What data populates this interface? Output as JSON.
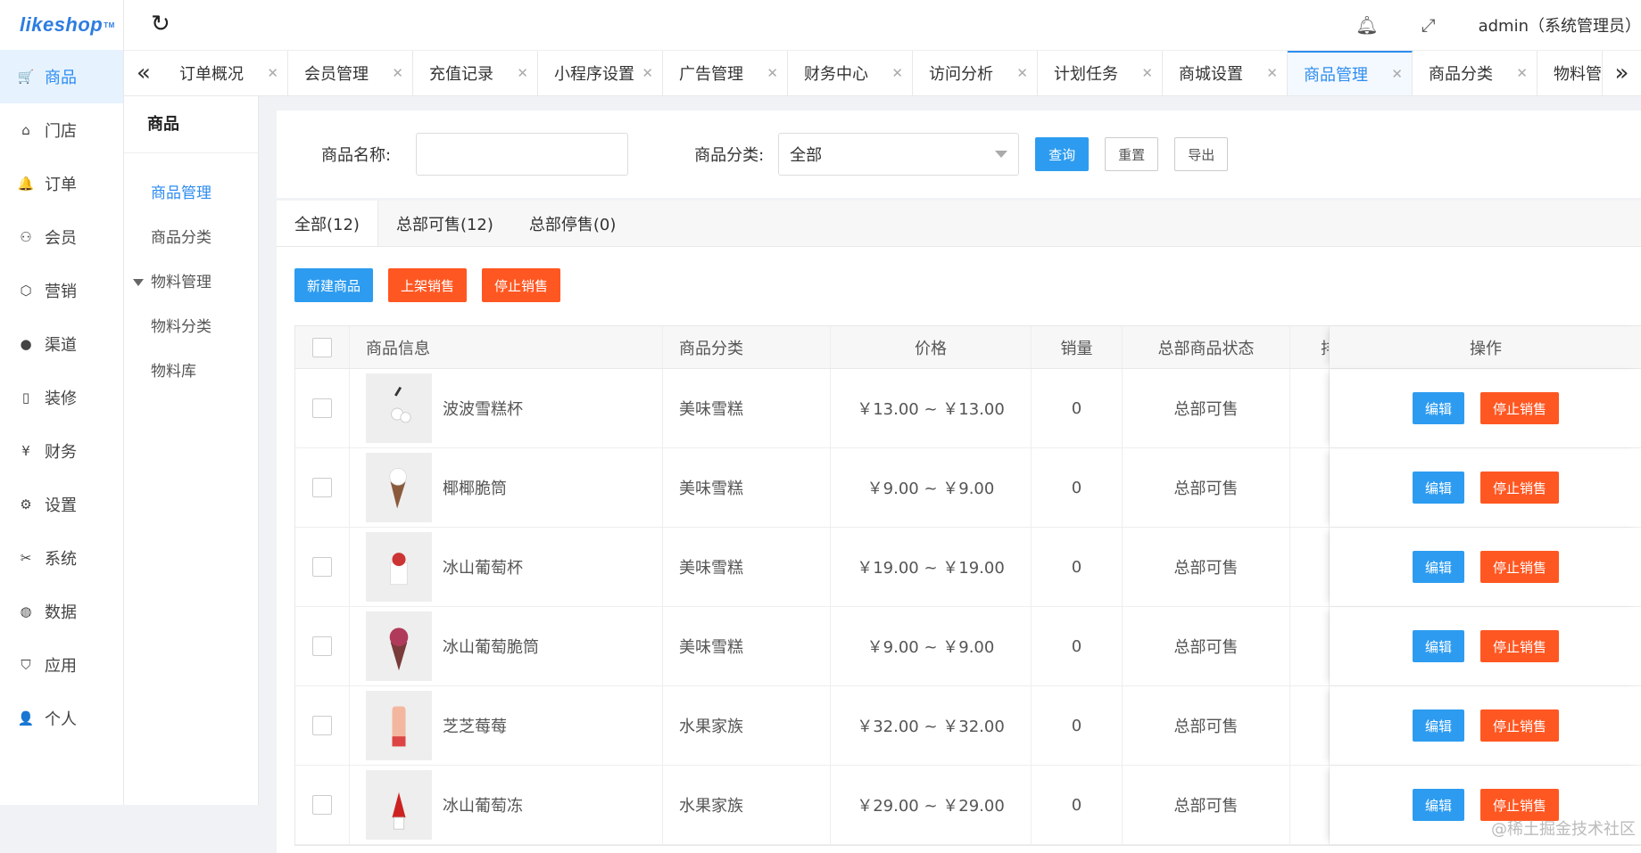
{
  "app": {
    "logo": "likeshop",
    "logo_tm": "TM"
  },
  "sidebar": {
    "items": [
      {
        "label": "商品",
        "icon": "cart-icon",
        "glyph": "🛒",
        "active": true
      },
      {
        "label": "门店",
        "icon": "home-icon",
        "glyph": "⌂"
      },
      {
        "label": "订单",
        "icon": "bell-icon",
        "glyph": "🔔"
      },
      {
        "label": "会员",
        "icon": "user-icon",
        "glyph": "⚇"
      },
      {
        "label": "营销",
        "icon": "cube-icon",
        "glyph": "⬡"
      },
      {
        "label": "渠道",
        "icon": "wechat-icon",
        "glyph": "●"
      },
      {
        "label": "装修",
        "icon": "tablet-icon",
        "glyph": "▯"
      },
      {
        "label": "财务",
        "icon": "yen-icon",
        "glyph": "¥"
      },
      {
        "label": "设置",
        "icon": "gear-icon",
        "glyph": "⚙"
      },
      {
        "label": "系统",
        "icon": "tools-icon",
        "glyph": "✂"
      },
      {
        "label": "数据",
        "icon": "globe-icon",
        "glyph": "◍"
      },
      {
        "label": "应用",
        "icon": "shield-check-icon",
        "glyph": "⛉"
      },
      {
        "label": "个人",
        "icon": "person-icon",
        "glyph": "👤"
      }
    ]
  },
  "header": {
    "user": "admin（系统管理员）"
  },
  "tabs": [
    {
      "label": "订单概况"
    },
    {
      "label": "会员管理"
    },
    {
      "label": "充值记录"
    },
    {
      "label": "小程序设置"
    },
    {
      "label": "广告管理"
    },
    {
      "label": "财务中心"
    },
    {
      "label": "访问分析"
    },
    {
      "label": "计划任务"
    },
    {
      "label": "商城设置"
    },
    {
      "label": "商品管理",
      "active": true
    },
    {
      "label": "商品分类"
    },
    {
      "label": "物料管理"
    }
  ],
  "subnav": {
    "title": "商品",
    "items": [
      {
        "label": "商品管理",
        "active": true
      },
      {
        "label": "商品分类"
      },
      {
        "label": "物料管理",
        "group": true
      },
      {
        "label": "物料分类"
      },
      {
        "label": "物料库"
      }
    ]
  },
  "filter": {
    "name_label": "商品名称:",
    "name_value": "",
    "category_label": "商品分类:",
    "category_value": "全部",
    "query_btn": "查询",
    "reset_btn": "重置",
    "export_btn": "导出"
  },
  "status_tabs": [
    {
      "label": "全部(12)",
      "active": true
    },
    {
      "label": "总部可售(12)"
    },
    {
      "label": "总部停售(0)"
    }
  ],
  "actions": {
    "new": "新建商品",
    "on_sale": "上架销售",
    "off_sale": "停止销售"
  },
  "table": {
    "headers": {
      "info": "商品信息",
      "category": "商品分类",
      "price": "价格",
      "sales": "销量",
      "status": "总部商品状态",
      "extra": "排",
      "ops": "操作"
    },
    "rows": [
      {
        "name": "波波雪糕杯",
        "category": "美味雪糕",
        "price": "￥13.00 ~ ￥13.00",
        "sales": "0",
        "status": "总部可售"
      },
      {
        "name": "椰椰脆筒",
        "category": "美味雪糕",
        "price": "￥9.00 ~ ￥9.00",
        "sales": "0",
        "status": "总部可售"
      },
      {
        "name": "冰山葡萄杯",
        "category": "美味雪糕",
        "price": "￥19.00 ~ ￥19.00",
        "sales": "0",
        "status": "总部可售"
      },
      {
        "name": "冰山葡萄脆筒",
        "category": "美味雪糕",
        "price": "￥9.00 ~ ￥9.00",
        "sales": "0",
        "status": "总部可售"
      },
      {
        "name": "芝芝莓莓",
        "category": "水果家族",
        "price": "￥32.00 ~ ￥32.00",
        "sales": "0",
        "status": "总部可售"
      },
      {
        "name": "冰山葡萄冻",
        "category": "水果家族",
        "price": "￥29.00 ~ ￥29.00",
        "sales": "0",
        "status": "总部可售"
      }
    ],
    "edit_btn": "编辑",
    "stop_btn": "停止销售"
  },
  "watermark": "@稀土掘金技术社区"
}
